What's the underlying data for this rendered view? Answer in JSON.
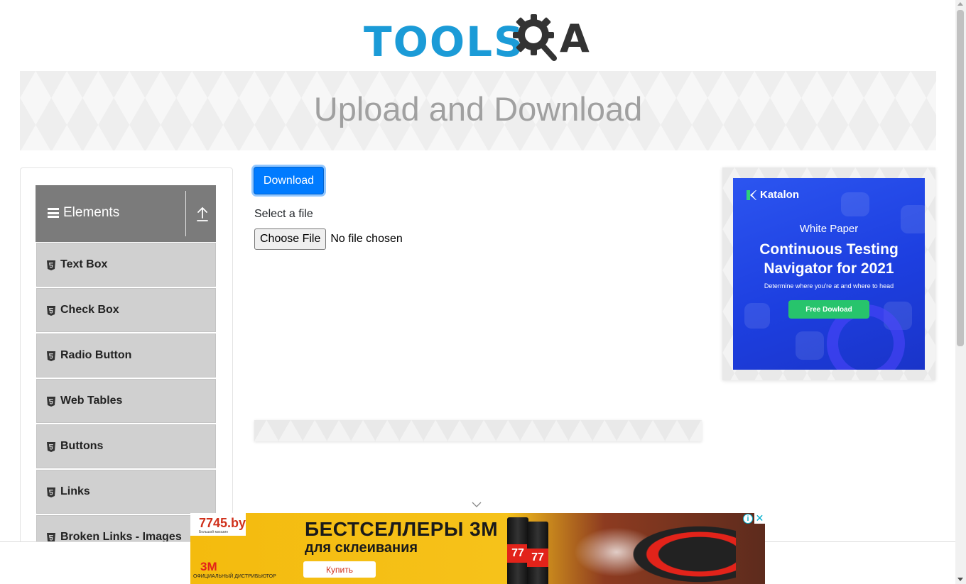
{
  "header": {
    "logo_text": "TOOLS",
    "logo_suffix": "A"
  },
  "banner": {
    "title": "Upload and Download"
  },
  "sidebar": {
    "group": {
      "title": "Elements",
      "icon": "menu-icon",
      "toggle_icon": "upload-arrow-icon"
    },
    "items": [
      {
        "label": "Text Box",
        "icon": "html5-shield-icon"
      },
      {
        "label": "Check Box",
        "icon": "html5-shield-icon"
      },
      {
        "label": "Radio Button",
        "icon": "html5-shield-icon"
      },
      {
        "label": "Web Tables",
        "icon": "html5-shield-icon"
      },
      {
        "label": "Buttons",
        "icon": "html5-shield-icon"
      },
      {
        "label": "Links",
        "icon": "html5-shield-icon"
      },
      {
        "label": "Broken Links - Images",
        "icon": "html5-shield-icon"
      }
    ]
  },
  "main": {
    "download_label": "Download",
    "select_file_label": "Select a file",
    "choose_file_label": "Choose File",
    "no_file_text": "No file chosen"
  },
  "right_ad": {
    "brand": "Katalon",
    "kind": "White Paper",
    "headline_line1": "Continuous Testing",
    "headline_line2": "Navigator for 2021",
    "subtext": "Determine where you're at and where to head",
    "cta": "Free Dowload"
  },
  "bottom_ad": {
    "shop": "7745.by",
    "shop_tagline": "Большой магазин",
    "headline": "БЕСТСЕЛЛЕРЫ 3М",
    "headline2": "для склеивания",
    "buy": "Купить",
    "brand": "3M",
    "distributor": "ОФИЦИАЛЬНЫЙ ДИСТРИБЬЮТОР",
    "can_label": "77",
    "info_icon": "info-icon",
    "close_icon": "close-icon"
  },
  "colors": {
    "logo_blue": "#1b9bd7",
    "logo_dark": "#333333",
    "primary": "#007bff",
    "sidebar_header": "#7b7b7b",
    "sidebar_item": "#d0d0d0",
    "katalon_blue": "#2c55f0",
    "katalon_green": "#27c46c",
    "ad_yellow": "#f4bb0e"
  }
}
